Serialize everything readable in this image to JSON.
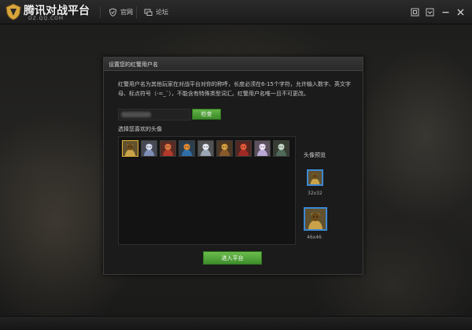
{
  "app": {
    "logo_text": "腾讯对战平台",
    "logo_sub": "DZ.QQ.COM"
  },
  "nav": [
    {
      "label": "官网",
      "icon": "shield-icon"
    },
    {
      "label": "论坛",
      "icon": "forum-icon"
    }
  ],
  "window_controls": [
    {
      "name": "skin-button",
      "icon": "skin-icon"
    },
    {
      "name": "menu-dropdown-button",
      "icon": "chevron-down-icon"
    },
    {
      "name": "minimize-button",
      "icon": "minimize-icon"
    },
    {
      "name": "close-button",
      "icon": "close-icon"
    }
  ],
  "dialog": {
    "title": "设置您的红警用户名",
    "description": "红警用户名为其他玩家在对战平台对你的称呼，长度必须在6-15个字符，允许输入数字、英文字母、标点符号（-=_`），不能含有特殊类型词汇。红警用户名唯一且不可更改。",
    "name_input_value": "",
    "check_button": "检查",
    "choose_avatar_label": "选择您喜欢的头像",
    "avatars": [
      {
        "id": "hero-1",
        "color": "#c9a24a",
        "accent": "#6a4a1a",
        "selected": true
      },
      {
        "id": "hero-2",
        "color": "#7f8fb8",
        "accent": "#d9e0f0",
        "selected": false
      },
      {
        "id": "hero-3",
        "color": "#b23a2a",
        "accent": "#e07a40",
        "selected": false
      },
      {
        "id": "hero-4",
        "color": "#2f6fa8",
        "accent": "#e08a30",
        "selected": false
      },
      {
        "id": "hero-5",
        "color": "#9aa7b6",
        "accent": "#e7ecf2",
        "selected": false
      },
      {
        "id": "hero-6",
        "color": "#8a5a2a",
        "accent": "#d6a040",
        "selected": false
      },
      {
        "id": "hero-7",
        "color": "#a02a24",
        "accent": "#e45a3a",
        "selected": false
      },
      {
        "id": "hero-8",
        "color": "#b9a7d6",
        "accent": "#f0e6ff",
        "selected": false
      },
      {
        "id": "hero-9",
        "color": "#4f6a5a",
        "accent": "#c8d8c8",
        "selected": false
      }
    ],
    "preview_label": "头像预览",
    "preview_small_size": "32x32",
    "preview_large_size": "46x46",
    "enter_button": "进入平台"
  },
  "colors": {
    "accent_green": "#4fa236",
    "preview_border": "#3c88d3",
    "selected_border": "#e0b23a"
  }
}
